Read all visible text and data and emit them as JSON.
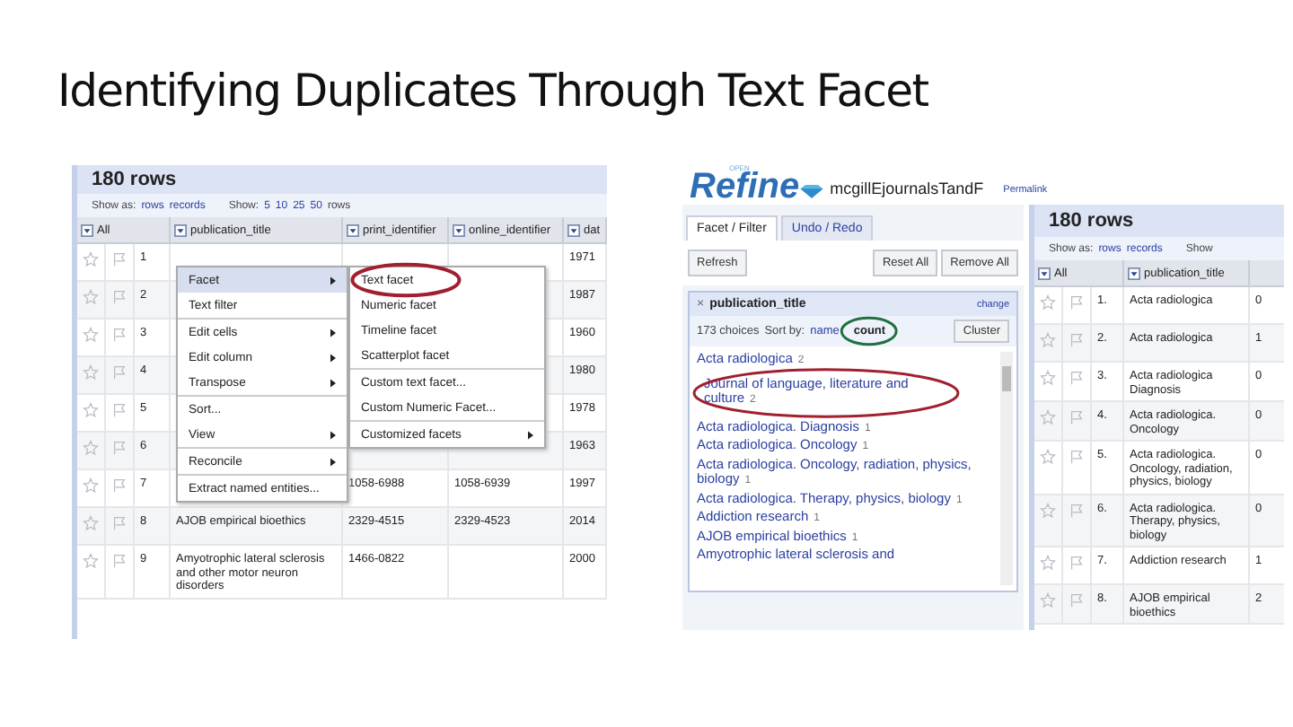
{
  "slide_title": "Identifying Duplicates Through Text Facet",
  "left_shot": {
    "row_count": "180 rows",
    "show_as_label": "Show as:",
    "show_as": [
      "rows",
      "records"
    ],
    "show_label": "Show:",
    "show": [
      "5",
      "10",
      "25",
      "50"
    ],
    "show_suffix": "rows",
    "columns": [
      "All",
      "publication_title",
      "print_identifier",
      "online_identifier",
      "dat"
    ],
    "rows": [
      {
        "number": "1",
        "date": "1971"
      },
      {
        "number": "2",
        "date": "1987"
      },
      {
        "number": "3",
        "date": "1960"
      },
      {
        "number": "4",
        "date": "1980"
      },
      {
        "number": "5",
        "date": "1978"
      },
      {
        "number": "6",
        "date": "1963"
      },
      {
        "number": "7",
        "print": "1058-6988",
        "online": "1058-6939",
        "date": "1997"
      },
      {
        "number": "8",
        "title": "AJOB empirical bioethics",
        "print": "2329-4515",
        "online": "2329-4523",
        "date": "2014"
      },
      {
        "number": "9",
        "title": "Amyotrophic lateral sclerosis and other motor neuron disorders",
        "print": "1466-0822",
        "date": "2000"
      }
    ],
    "menu": [
      [
        {
          "label": "Facet",
          "submenu": true,
          "selected": true
        },
        {
          "label": "Text filter",
          "submenu": false,
          "selected": false
        }
      ],
      [
        {
          "label": "Edit cells",
          "submenu": true,
          "selected": false
        },
        {
          "label": "Edit column",
          "submenu": true,
          "selected": false
        },
        {
          "label": "Transpose",
          "submenu": true,
          "selected": false
        }
      ],
      [
        {
          "label": "Sort...",
          "submenu": false,
          "selected": false
        },
        {
          "label": "View",
          "submenu": true,
          "selected": false
        }
      ],
      [
        {
          "label": "Reconcile",
          "submenu": true,
          "selected": false
        }
      ],
      [
        {
          "label": "Extract named entities...",
          "submenu": false,
          "selected": false
        }
      ]
    ],
    "submenu": [
      [
        {
          "label": "Text facet",
          "submenu": false,
          "circled": true,
          "color": "#a02030"
        },
        {
          "label": "Numeric facet",
          "submenu": false,
          "circled": false
        },
        {
          "label": "Timeline facet",
          "submenu": false,
          "circled": false
        },
        {
          "label": "Scatterplot facet",
          "submenu": false,
          "circled": false
        }
      ],
      [
        {
          "label": "Custom text facet...",
          "submenu": false,
          "circled": false
        },
        {
          "label": "Custom Numeric Facet...",
          "submenu": false,
          "circled": false
        }
      ],
      [
        {
          "label": "Customized facets",
          "submenu": true,
          "circled": false
        }
      ]
    ]
  },
  "right_shot": {
    "logo_badge": "OPEN",
    "logo": "Refine",
    "project": "mcgillEjournalsTandF",
    "permalink": "Permalink",
    "tabs": [
      {
        "label": "Facet / Filter",
        "selected": true
      },
      {
        "label": "Undo / Redo",
        "selected": false
      }
    ],
    "buttons": [
      "Refresh",
      "Reset All",
      "Remove All"
    ],
    "facet": {
      "close": "×",
      "title": "publication_title",
      "change": "change",
      "choices": "173 choices",
      "sort_label": "Sort by:",
      "sort_options": [
        {
          "label": "name",
          "selected": false
        },
        {
          "label": "count",
          "selected": true,
          "color": "#207040"
        }
      ],
      "cluster": "Cluster",
      "items": [
        {
          "label": "Acta radiologica",
          "count": "2",
          "circled": false
        },
        {
          "label": "Journal of language, literature and culture",
          "count": "2",
          "circled": true,
          "color": "#a02030"
        },
        {
          "label": "Acta radiologica. Diagnosis",
          "count": "1",
          "circled": false
        },
        {
          "label": "Acta radiologica. Oncology",
          "count": "1",
          "circled": false
        },
        {
          "label": "Acta radiologica. Oncology, radiation, physics, biology",
          "count": "1",
          "circled": false
        },
        {
          "label": "Acta radiologica. Therapy, physics, biology",
          "count": "1",
          "circled": false
        },
        {
          "label": "Addiction research",
          "count": "1",
          "circled": false
        },
        {
          "label": "AJOB empirical bioethics",
          "count": "1",
          "circled": false
        },
        {
          "label": "Amyotrophic lateral sclerosis and",
          "circled": false
        }
      ]
    },
    "row_count": "180 rows",
    "show_as_label": "Show as:",
    "show_as": [
      "rows",
      "records"
    ],
    "show_label": "Show",
    "columns": [
      "All",
      "publication_title"
    ],
    "rows": [
      {
        "number": "1.",
        "title": "Acta radiologica",
        "next": "0"
      },
      {
        "number": "2.",
        "title": "Acta radiologica",
        "next": "1"
      },
      {
        "number": "3.",
        "title": "Acta radiologica Diagnosis",
        "next": "0"
      },
      {
        "number": "4.",
        "title": "Acta radiologica. Oncology",
        "next": "0"
      },
      {
        "number": "5.",
        "title": "Acta radiologica. Oncology, radiation, physics, biology",
        "next": "0"
      },
      {
        "number": "6.",
        "title": "Acta radiologica. Therapy, physics, biology",
        "next": "0"
      },
      {
        "number": "7.",
        "title": "Addiction research",
        "next": "1"
      },
      {
        "number": "8.",
        "title": "AJOB empirical bioethics",
        "next": "2"
      }
    ]
  }
}
